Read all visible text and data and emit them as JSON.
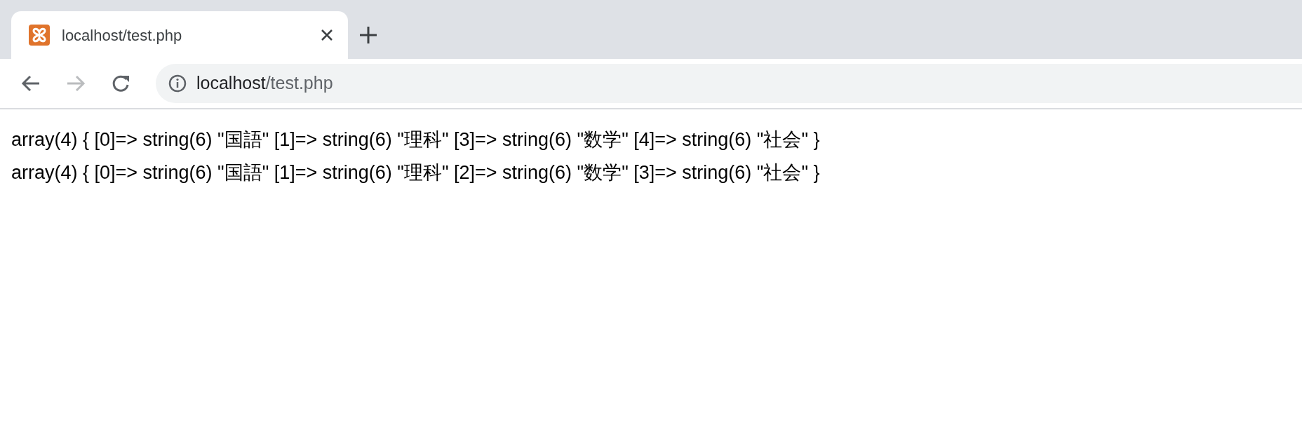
{
  "tabs": [
    {
      "title": "localhost/test.php",
      "selected": true
    }
  ],
  "address_bar": {
    "host": "localhost",
    "path": "/test.php"
  },
  "page": {
    "lines": [
      "array(4) { [0]=> string(6) \"国語\" [1]=> string(6) \"理科\" [3]=> string(6) \"数学\" [4]=> string(6) \"社会\" }",
      "array(4) { [0]=> string(6) \"国語\" [1]=> string(6) \"理科\" [2]=> string(6) \"数学\" [3]=> string(6) \"社会\" }"
    ]
  }
}
